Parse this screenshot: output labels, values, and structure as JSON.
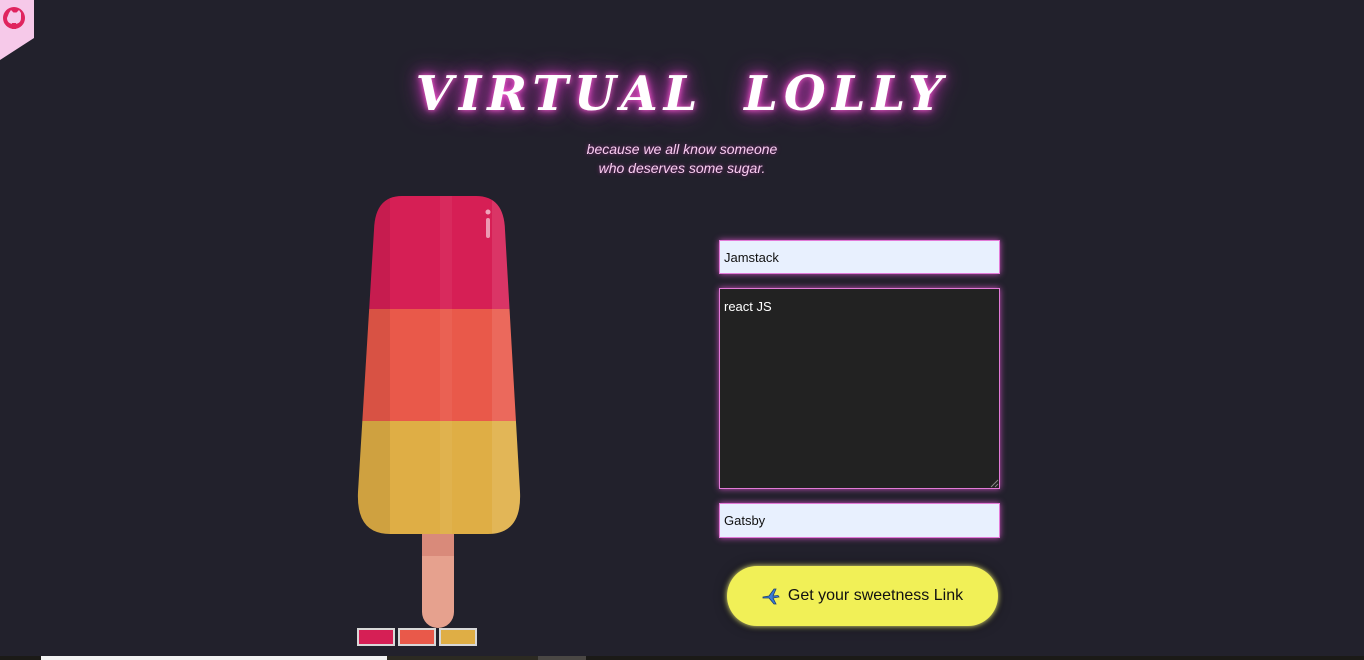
{
  "header": {
    "title": "VIRTUAL LOLLY",
    "subtitle_line1": "because we all know someone",
    "subtitle_line2": "who deserves some sugar."
  },
  "corner": {
    "icon": "github-icon"
  },
  "lolly": {
    "colors": {
      "top": "#d61f55",
      "middle": "#e9594a",
      "bottom": "#dfae45"
    },
    "stick_color": "#e6a18e",
    "swatches": [
      "#d61f55",
      "#e9594a",
      "#dfae45"
    ]
  },
  "form": {
    "to_value": "Jamstack",
    "message_value": "react JS",
    "from_value": "Gatsby",
    "submit_label": "Get your sweetness Link",
    "submit_icon": "airplane-icon"
  },
  "colors": {
    "background": "#22212c",
    "glow": "#d63cc4",
    "button": "#f1f057"
  }
}
